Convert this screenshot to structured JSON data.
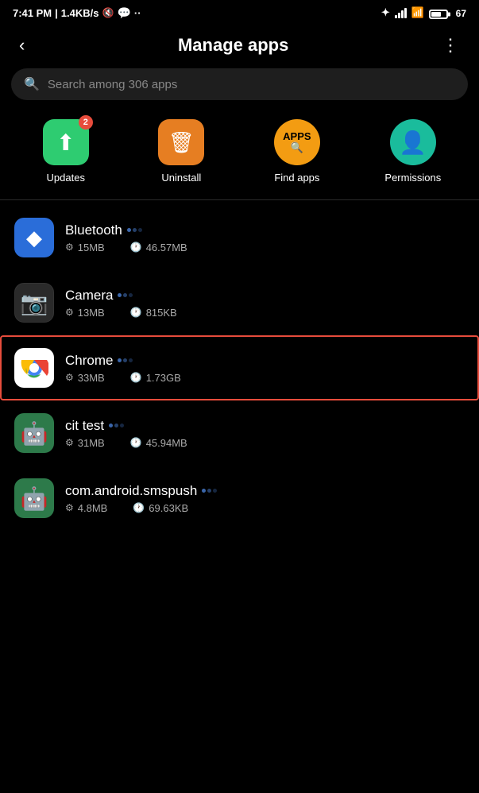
{
  "statusBar": {
    "time": "7:41 PM",
    "network": "1.4KB/s",
    "battery": 67,
    "batteryLabel": "67"
  },
  "header": {
    "title": "Manage apps",
    "backLabel": "‹",
    "menuLabel": "⋮"
  },
  "search": {
    "placeholder": "Search among 306 apps"
  },
  "quickActions": [
    {
      "id": "updates",
      "label": "Updates",
      "badge": "2"
    },
    {
      "id": "uninstall",
      "label": "Uninstall",
      "badge": null
    },
    {
      "id": "findapps",
      "label": "Find apps",
      "badge": null
    },
    {
      "id": "permissions",
      "label": "Permissions",
      "badge": null
    }
  ],
  "apps": [
    {
      "id": "bluetooth",
      "name": "Bluetooth",
      "storage": "15MB",
      "cache": "46.57MB",
      "highlighted": false
    },
    {
      "id": "camera",
      "name": "Camera",
      "storage": "13MB",
      "cache": "815KB",
      "highlighted": false
    },
    {
      "id": "chrome",
      "name": "Chrome",
      "storage": "33MB",
      "cache": "1.73GB",
      "highlighted": true
    },
    {
      "id": "cit",
      "name": "cit test",
      "storage": "31MB",
      "cache": "45.94MB",
      "highlighted": false
    },
    {
      "id": "smspush",
      "name": "com.android.smspush",
      "storage": "4.8MB",
      "cache": "69.63KB",
      "highlighted": false
    }
  ]
}
